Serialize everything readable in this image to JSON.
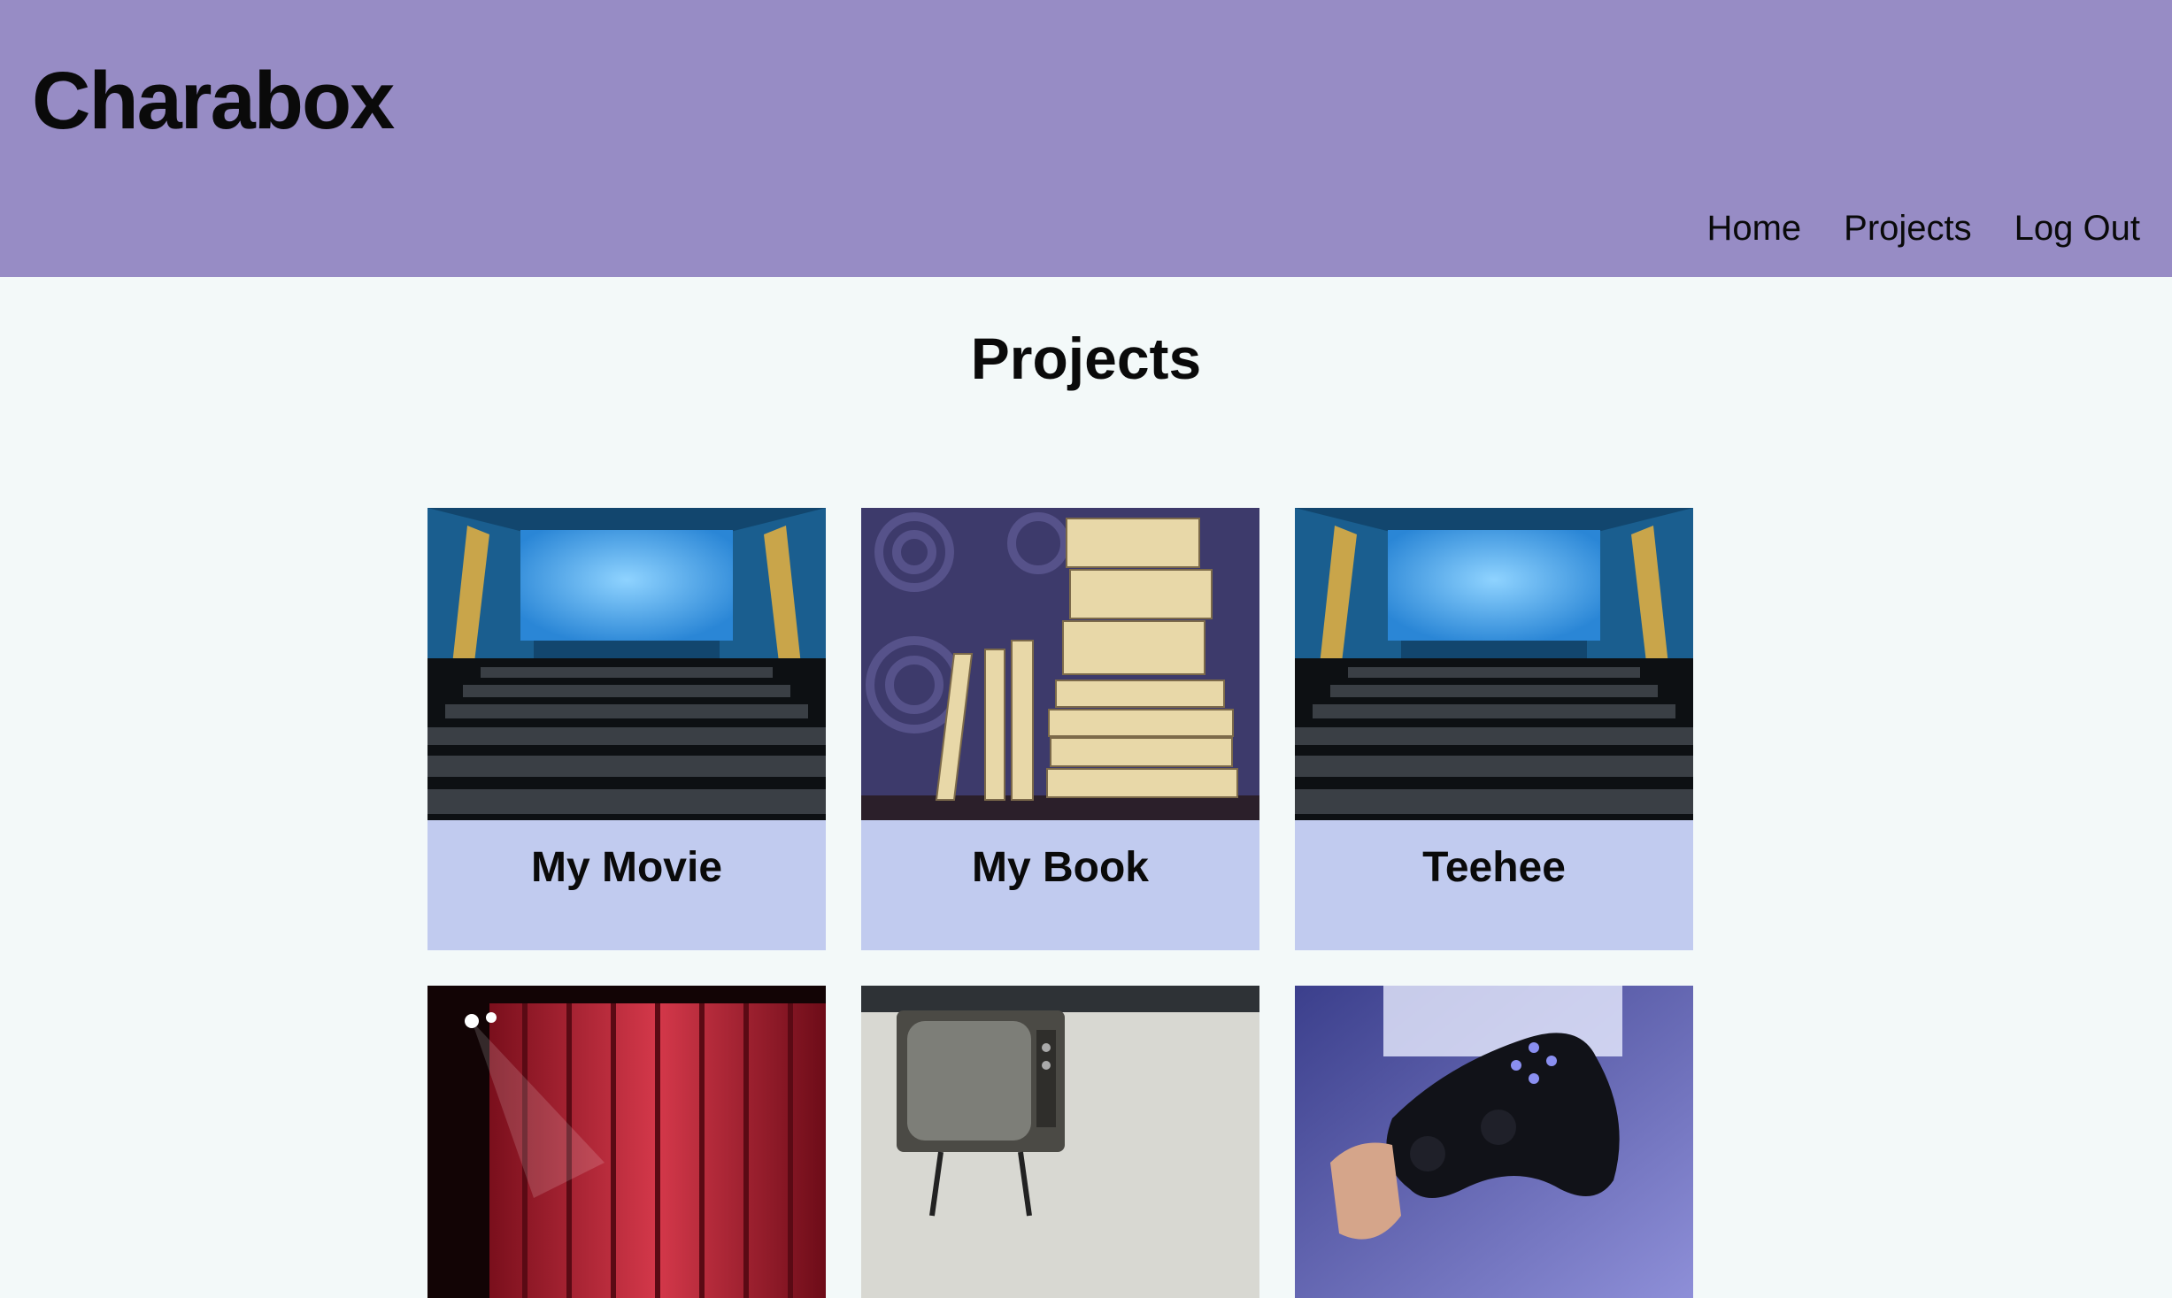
{
  "header": {
    "logo": "Charabox",
    "nav": [
      {
        "label": "Home"
      },
      {
        "label": "Projects"
      },
      {
        "label": "Log Out"
      }
    ]
  },
  "main": {
    "title": "Projects",
    "projects": [
      {
        "name": "My Movie",
        "image": "cinema-screen"
      },
      {
        "name": "My Book",
        "image": "book-stack"
      },
      {
        "name": "Teehee",
        "image": "cinema-screen"
      },
      {
        "name": "",
        "image": "red-stage-curtain"
      },
      {
        "name": "",
        "image": "retro-tv"
      },
      {
        "name": "",
        "image": "game-controller"
      }
    ]
  },
  "colors": {
    "header_bg": "#978cc5",
    "page_bg": "#f3f9f9",
    "card_label_bg": "#c1cbef"
  }
}
